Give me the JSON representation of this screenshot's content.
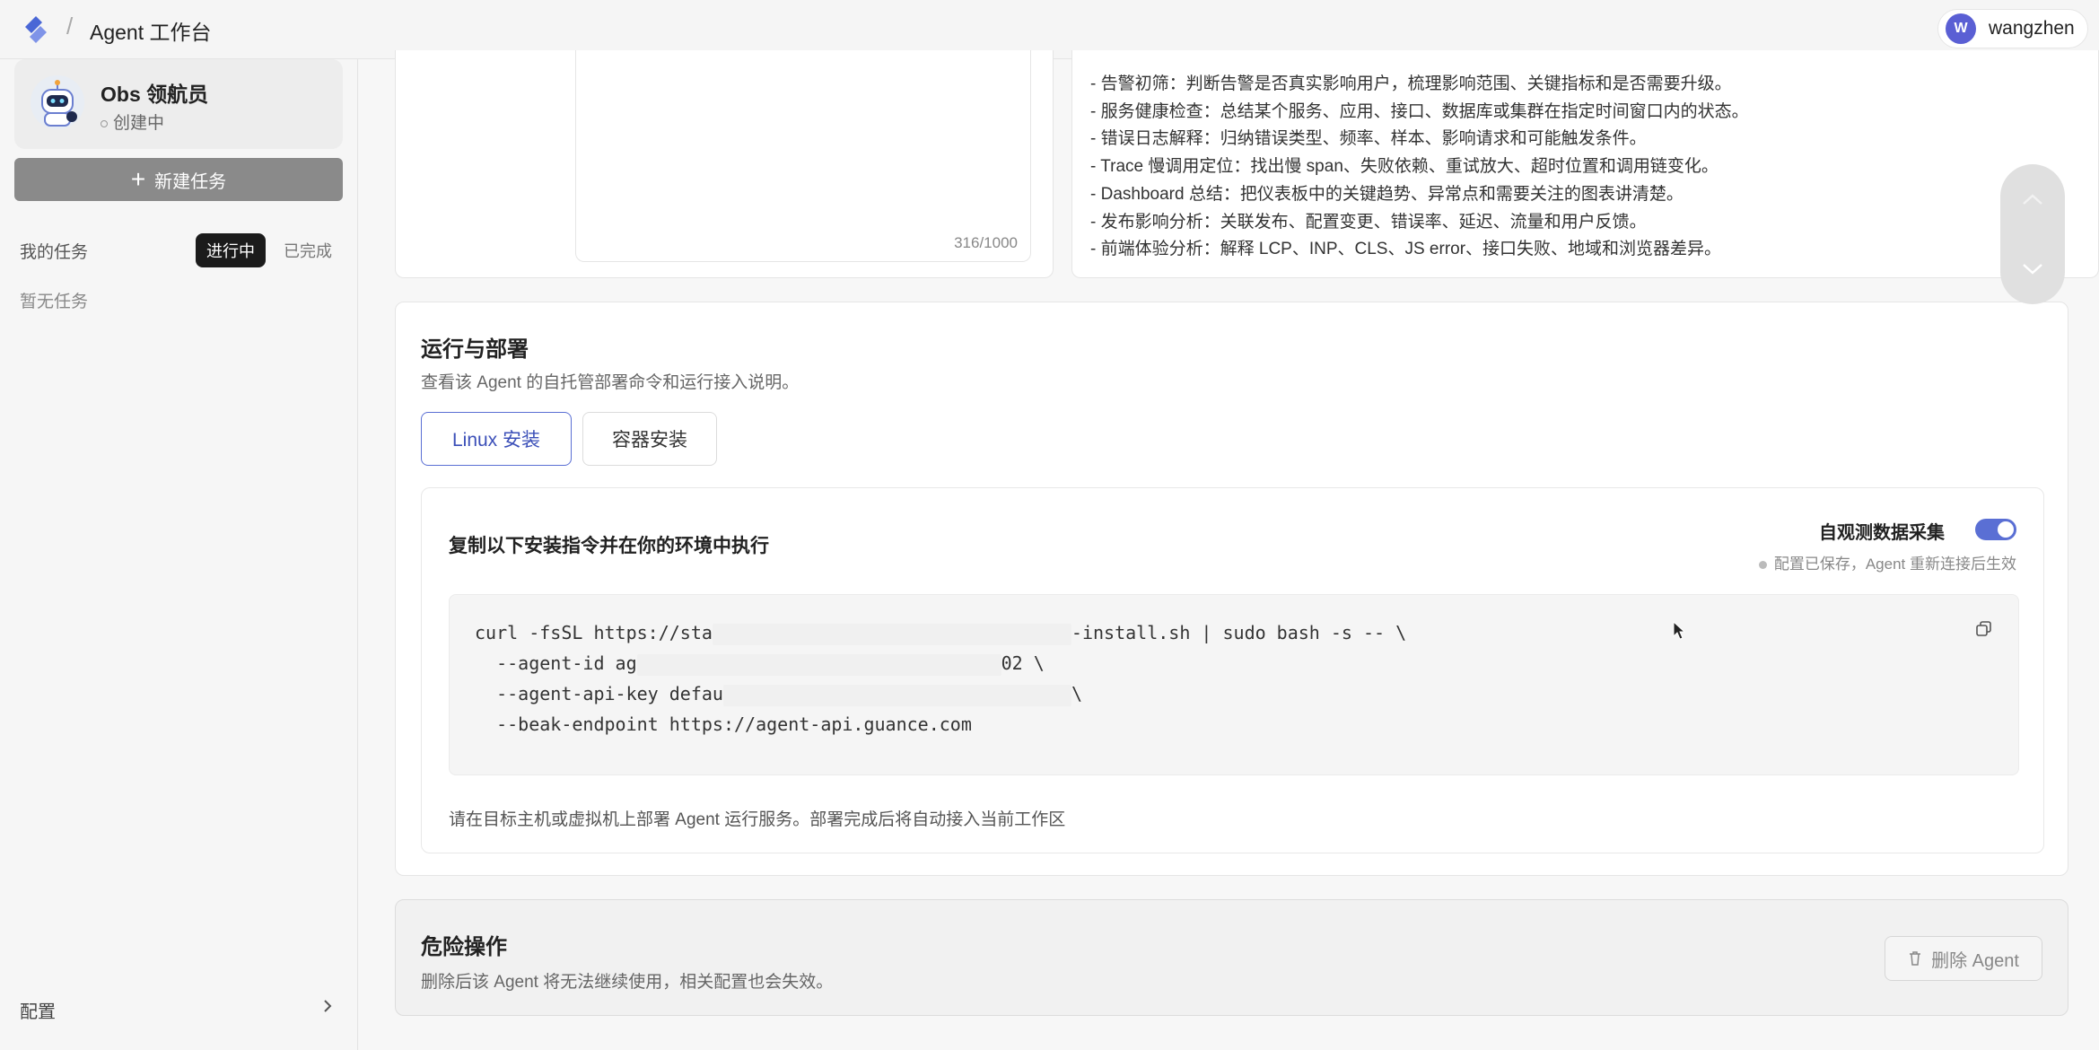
{
  "header": {
    "separator": "/",
    "title": "Agent 工作台",
    "user_initial": "W",
    "user_name": "wangzhen"
  },
  "sidebar": {
    "agent_name": "Obs 领航员",
    "agent_status": "创建中",
    "new_task_label": "新建任务",
    "my_tasks_label": "我的任务",
    "tabs": [
      "进行中",
      "已完成"
    ],
    "empty_text": "暂无任务",
    "config_label": "配置"
  },
  "prompt_panel": {
    "char_count": "316/1000",
    "guide_lines": [
      "- 告警初筛：判断告警是否真实影响用户，梳理影响范围、关键指标和是否需要升级。",
      "- 服务健康检查：总结某个服务、应用、接口、数据库或集群在指定时间窗口内的状态。",
      "- 错误日志解释：归纳错误类型、频率、样本、影响请求和可能触发条件。",
      "- Trace 慢调用定位：找出慢 span、失败依赖、重试放大、超时位置和调用链变化。",
      "- Dashboard 总结：把仪表板中的关键趋势、异常点和需要关注的图表讲清楚。",
      "- 发布影响分析：关联发布、配置变更、错误率、延迟、流量和用户反馈。",
      "- 前端体验分析：解释 LCP、INP、CLS、JS error、接口失败、地域和浏览器差异。"
    ]
  },
  "deploy": {
    "title": "运行与部署",
    "desc": "查看该 Agent 的自托管部署命令和运行接入说明。",
    "tabs": [
      "Linux 安装",
      "容器安装"
    ],
    "card_title": "复制以下安装指令并在你的环境中执行",
    "toggle_label": "自观测数据采集",
    "toggle_on": true,
    "saved_hint": "配置已保存，Agent 重新连接后生效",
    "code": {
      "l1_a": "curl -fsSL https://sta",
      "l1_b": "-install.sh | sudo bash -s -- \\",
      "l2_a": "  --agent-id ag",
      "l2_b": "02 \\",
      "l3_a": "  --agent-api-key defau",
      "l3_b": "\\",
      "l4": "  --beak-endpoint https://agent-api.guance.com"
    },
    "footer_note": "请在目标主机或虚拟机上部署 Agent 运行服务。部署完成后将自动接入当前工作区"
  },
  "danger": {
    "title": "危险操作",
    "desc": "删除后该 Agent 将无法继续使用，相关配置也会失效。",
    "delete_label": "删除 Agent"
  },
  "colors": {
    "accent": "#5a6fd4",
    "dark_tab": "#1b1b1b",
    "new_task_bg": "#8a8a8a"
  }
}
